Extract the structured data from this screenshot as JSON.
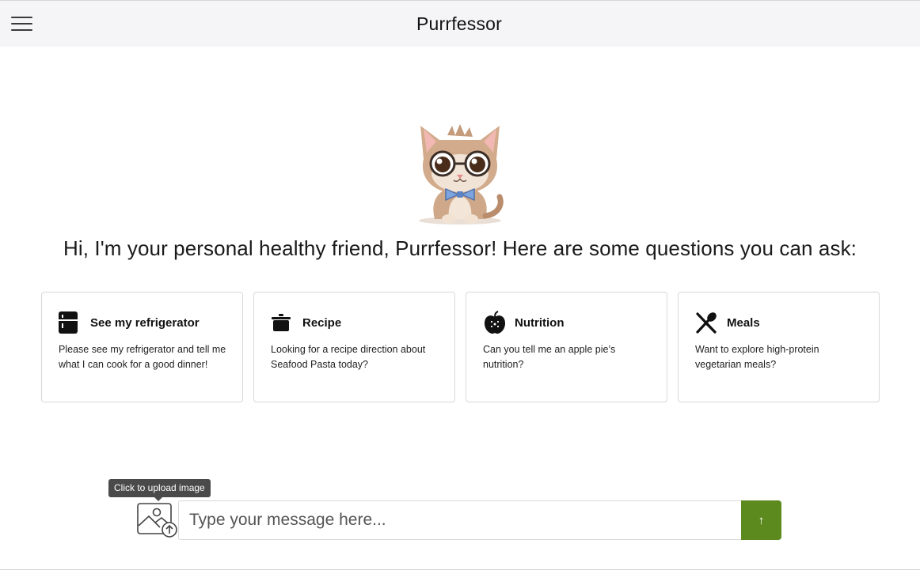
{
  "header": {
    "title": "Purrfessor",
    "menu_icon": "hamburger-menu-icon"
  },
  "mascot": {
    "icon": "cat-mascot-with-glasses-and-bowtie"
  },
  "greeting": "Hi, I'm your personal healthy friend, Purrfessor! Here are some questions you can ask:",
  "cards": [
    {
      "icon": "refrigerator-icon",
      "title": "See my refrigerator",
      "body": "Please see my refrigerator and tell me what I can cook for a good dinner!"
    },
    {
      "icon": "cooking-pot-icon",
      "title": "Recipe",
      "body": "Looking for a recipe direction about Seafood Pasta today?"
    },
    {
      "icon": "apple-icon",
      "title": "Nutrition",
      "body": "Can you tell me an apple pie’s nutrition?"
    },
    {
      "icon": "fork-spoon-icon",
      "title": "Meals",
      "body": "Want to explore high-protein vegetarian meals?"
    }
  ],
  "composer": {
    "tooltip": "Click to upload image",
    "upload_icon": "image-upload-icon",
    "placeholder": "Type your message here...",
    "value": "",
    "send_icon": "arrow-up-icon",
    "send_color": "#5c8a1f"
  },
  "colors": {
    "accent": "#5c8a1f",
    "header_bg": "#f5f5f7"
  }
}
